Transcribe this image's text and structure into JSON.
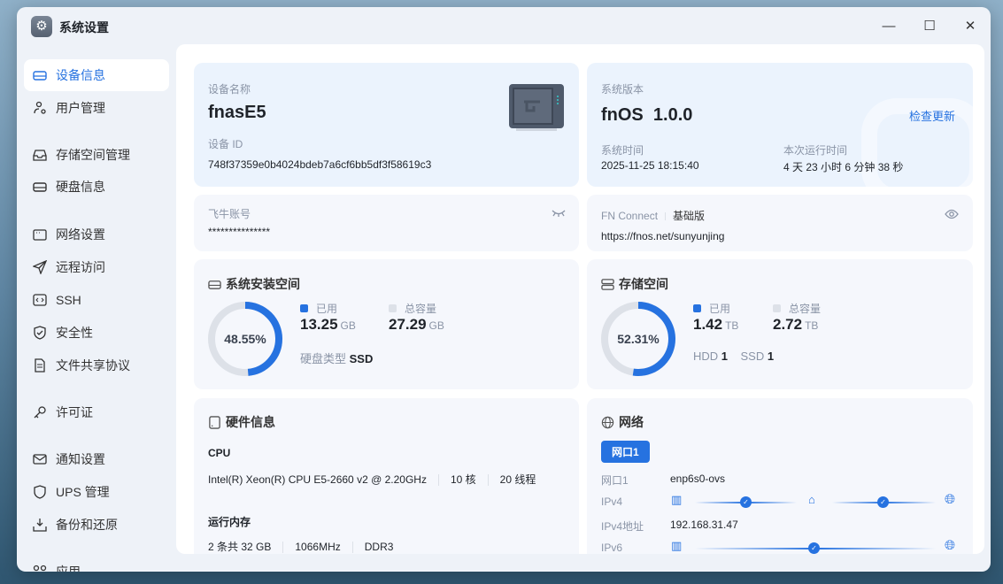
{
  "window": {
    "title": "系统设置",
    "min": "—",
    "max": "☐",
    "close": "✕"
  },
  "sidebar": {
    "items": [
      {
        "label": "设备信息",
        "icon": "drive-icon"
      },
      {
        "label": "用户管理",
        "icon": "user-gear-icon"
      },
      {
        "label": "存储空间管理",
        "icon": "inbox-icon"
      },
      {
        "label": "硬盘信息",
        "icon": "drive-icon"
      },
      {
        "label": "网络设置",
        "icon": "window-icon"
      },
      {
        "label": "远程访问",
        "icon": "send-icon"
      },
      {
        "label": "SSH",
        "icon": "terminal-icon"
      },
      {
        "label": "安全性",
        "icon": "shield-check-icon"
      },
      {
        "label": "文件共享协议",
        "icon": "file-icon"
      },
      {
        "label": "许可证",
        "icon": "key-icon"
      },
      {
        "label": "通知设置",
        "icon": "mail-icon"
      },
      {
        "label": "UPS 管理",
        "icon": "shield-icon"
      },
      {
        "label": "备份和还原",
        "icon": "download-icon"
      },
      {
        "label": "应用",
        "icon": "apps-icon"
      }
    ]
  },
  "device": {
    "name_label": "设备名称",
    "name": "fnasE5",
    "id_label": "设备 ID",
    "id": "748f37359e0b4024bdeb7a6cf6bb5df3f58619c3"
  },
  "version": {
    "label": "系统版本",
    "os": "fnOS",
    "ver": "1.0.0",
    "check": "检查更新",
    "time_label": "系统时间",
    "time": "2025-11-25 18:15:40",
    "uptime_label": "本次运行时间",
    "uptime": "4 天 23 小时 6 分钟 38 秒"
  },
  "account": {
    "label": "飞牛账号",
    "value": "***************"
  },
  "connect": {
    "label": "FN Connect",
    "tier": "基础版",
    "url": "https://fnos.net/sunyunjing"
  },
  "sys_space": {
    "title": "系统安装空间",
    "percent": 48.55,
    "percent_text": "48.55%",
    "used_label": "已用",
    "used": "13.25",
    "used_unit": "GB",
    "total_label": "总容量",
    "total": "27.29",
    "total_unit": "GB",
    "disk_type_label": "硬盘类型",
    "disk_type": "SSD"
  },
  "storage": {
    "title": "存储空间",
    "percent": 52.31,
    "percent_text": "52.31%",
    "used_label": "已用",
    "used": "1.42",
    "used_unit": "TB",
    "total_label": "总容量",
    "total": "2.72",
    "total_unit": "TB",
    "hdd_label": "HDD",
    "hdd": "1",
    "ssd_label": "SSD",
    "ssd": "1"
  },
  "hardware": {
    "title": "硬件信息",
    "cpu_label": "CPU",
    "cpu": "Intel(R) Xeon(R) CPU E5-2660 v2 @ 2.20GHz",
    "cores": "10 核",
    "threads": "20 线程",
    "mem_label": "运行内存",
    "mem": "2 条共 32 GB",
    "mem_freq": "1066MHz",
    "mem_type": "DDR3"
  },
  "network": {
    "title": "网络",
    "tab": "网口1",
    "port_label": "网口1",
    "port": "enp6s0-ovs",
    "ipv4_label": "IPv4",
    "ipv4_addr_label": "IPv4地址",
    "ipv4_addr": "192.168.31.47",
    "ipv6_label": "IPv6"
  },
  "colors": {
    "accent": "#2672e0",
    "track": "#dde1e8"
  }
}
